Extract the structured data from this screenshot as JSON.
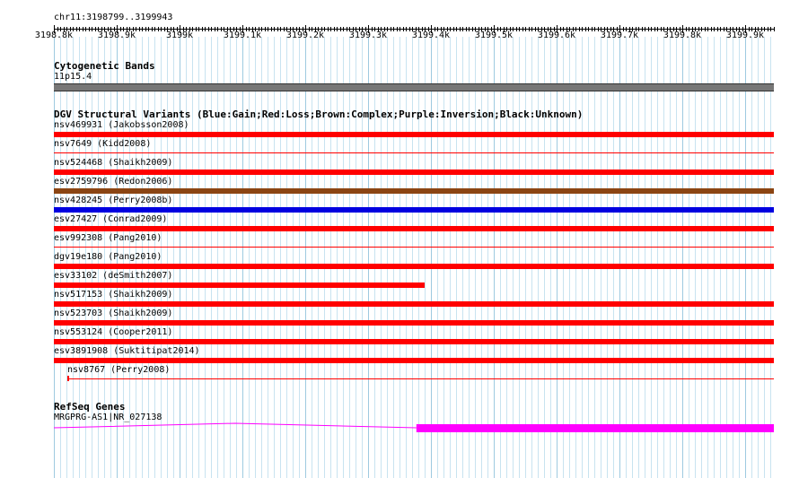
{
  "ruler": {
    "region": "chr11:3198799..3199943",
    "ticks": [
      "3198.8k",
      "3198.9k",
      "3199k",
      "3199.1k",
      "3199.2k",
      "3199.3k",
      "3199.4k",
      "3199.5k",
      "3199.6k",
      "3199.7k",
      "3199.8k",
      "3199.9k"
    ]
  },
  "cytoband": {
    "title": "Cytogenetic Bands",
    "band_label": "11p15.4",
    "color": "#777777"
  },
  "dgv": {
    "title": "DGV Structural Variants (Blue:Gain;Red:Loss;Brown:Complex;Purple:Inversion;Black:Unknown)",
    "colors": {
      "loss": "#ff0000",
      "gain": "#0000e0",
      "complex": "#8b4513"
    },
    "variants": [
      {
        "label": "nsv469931 (Jakobsson2008)",
        "type": "loss",
        "start": 3198799,
        "end": 3199943,
        "style": "bar"
      },
      {
        "label": "nsv7649 (Kidd2008)",
        "type": "loss",
        "start": 3198799,
        "end": 3199943,
        "style": "thin"
      },
      {
        "label": "nsv524468 (Shaikh2009)",
        "type": "loss",
        "start": 3198799,
        "end": 3199943,
        "style": "bar"
      },
      {
        "label": "esv2759796 (Redon2006)",
        "type": "complex",
        "start": 3198799,
        "end": 3199943,
        "style": "bar"
      },
      {
        "label": "nsv428245 (Perry2008b)",
        "type": "gain",
        "start": 3198799,
        "end": 3199943,
        "style": "bar"
      },
      {
        "label": "esv27427 (Conrad2009)",
        "type": "loss",
        "start": 3198799,
        "end": 3199943,
        "style": "bar"
      },
      {
        "label": "esv992308 (Pang2010)",
        "type": "loss",
        "start": 3198799,
        "end": 3199943,
        "style": "thin"
      },
      {
        "label": "dgv19e180 (Pang2010)",
        "type": "loss",
        "start": 3198799,
        "end": 3199943,
        "style": "bar"
      },
      {
        "label": "esv33102 (deSmith2007)",
        "type": "loss",
        "start": 3198799,
        "end": 3199388,
        "style": "bar"
      },
      {
        "label": "nsv517153 (Shaikh2009)",
        "type": "loss",
        "start": 3198799,
        "end": 3199943,
        "style": "bar"
      },
      {
        "label": "nsv523703 (Shaikh2009)",
        "type": "loss",
        "start": 3198799,
        "end": 3199943,
        "style": "bar"
      },
      {
        "label": "nsv553124 (Cooper2011)",
        "type": "loss",
        "start": 3198799,
        "end": 3199943,
        "style": "bar"
      },
      {
        "label": "esv3891908 (Suktitipat2014)",
        "type": "loss",
        "start": 3198799,
        "end": 3199943,
        "style": "bar"
      },
      {
        "label": "nsv8767 (Perry2008)",
        "type": "loss",
        "start": 3198821,
        "end": 3199943,
        "style": "thin"
      }
    ]
  },
  "refseq": {
    "title": "RefSeq Genes",
    "gene_label": "MRGPRG-AS1|NR_027138",
    "color": "#ff00ff",
    "intron_start": 3198799,
    "exon_start": 3199375,
    "exon_end": 3199943
  }
}
